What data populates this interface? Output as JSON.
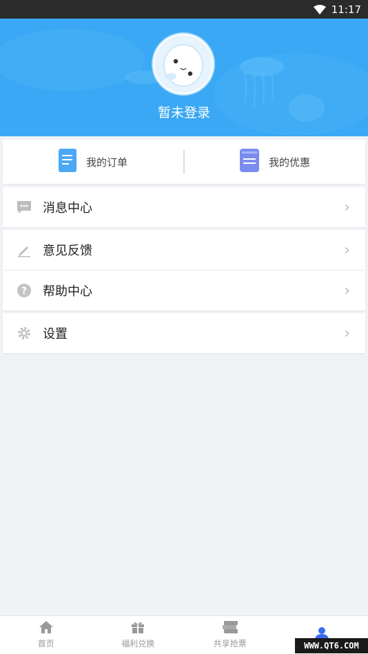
{
  "status_bar": {
    "time": "11:17",
    "wifi_icon": "wifi-icon"
  },
  "header": {
    "login_text": "暂未登录",
    "avatar_icon": "mascot-avatar",
    "bg_color": "#3aa8f4"
  },
  "quick_links": [
    {
      "label": "我的订单",
      "icon": "order-icon"
    },
    {
      "label": "我的优惠",
      "icon": "coupon-icon"
    }
  ],
  "menu": [
    {
      "label": "消息中心",
      "icon": "message-icon"
    },
    {
      "label": "意见反馈",
      "icon": "edit-icon"
    },
    {
      "label": "帮助中心",
      "icon": "help-icon"
    },
    {
      "label": "设置",
      "icon": "gear-icon"
    }
  ],
  "bottom_nav": [
    {
      "label": "首页",
      "icon": "home-icon"
    },
    {
      "label": "福利兑换",
      "icon": "gift-icon"
    },
    {
      "label": "共享抢票",
      "icon": "ticket-icon"
    },
    {
      "label": "",
      "icon": "user-icon",
      "active": true
    }
  ],
  "watermark": "WWW.QT6.COM",
  "colors": {
    "accent": "#3b6cf0",
    "header_blue": "#3aa8f4"
  }
}
